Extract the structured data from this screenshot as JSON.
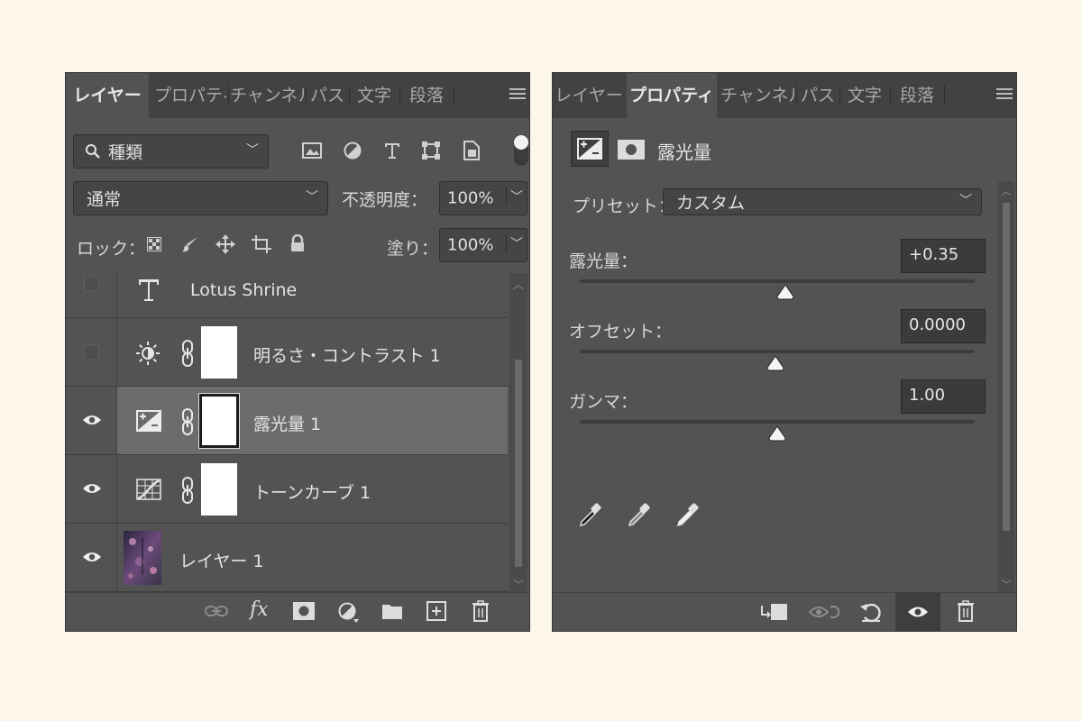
{
  "layers_panel": {
    "tabs": [
      "レイヤー",
      "プロパティ",
      "チャンネル",
      "パス",
      "文字",
      "段落"
    ],
    "filter_dropdown": "種類",
    "blend_mode": "通常",
    "opacity_label": "不透明度：",
    "opacity_value": "100%",
    "lock_label": "ロック：",
    "fill_label": "塗り：",
    "fill_value": "100%",
    "layers": [
      {
        "name": "Lotus Shrine",
        "type": "text",
        "visible": false,
        "selected": false
      },
      {
        "name": "明るさ・コントラスト 1",
        "type": "brightness-contrast",
        "visible": false,
        "selected": false
      },
      {
        "name": "露光量 1",
        "type": "exposure",
        "visible": true,
        "selected": true
      },
      {
        "name": "トーンカーブ 1",
        "type": "curves",
        "visible": true,
        "selected": false
      },
      {
        "name": "レイヤー 1",
        "type": "pixel",
        "visible": true,
        "selected": false
      }
    ]
  },
  "properties_panel": {
    "tabs": [
      "レイヤー",
      "プロパティ",
      "チャンネル",
      "パス",
      "文字",
      "段落"
    ],
    "title": "露光量",
    "preset_label": "プリセット：",
    "preset_value": "カスタム",
    "exposure_label": "露光量：",
    "exposure_value": "+0.35",
    "offset_label": "オフセット：",
    "offset_value": "0.0000",
    "gamma_label": "ガンマ：",
    "gamma_value": "1.00"
  }
}
